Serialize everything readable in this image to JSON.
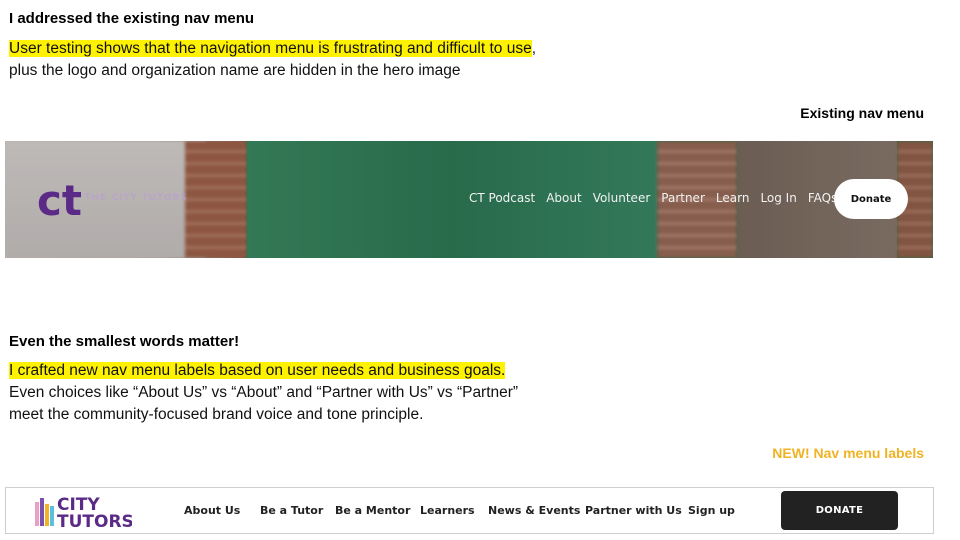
{
  "section1": {
    "heading": "I addressed the existing nav menu",
    "line1_highlight": "User testing shows that the navigation menu is frustrating and difficult to use",
    "line1_tail": ",",
    "line2": "plus the logo and organization name are hidden in the hero image"
  },
  "existing_label": "Existing nav menu",
  "old_nav": {
    "logo_mark": "ct",
    "logo_text": "THE CITY TUTORS",
    "items": [
      "CT Podcast",
      "About",
      "Volunteer",
      "Partner",
      "Learn",
      "Log In",
      "FAQs"
    ],
    "donate_label": "Donate"
  },
  "section2": {
    "heading": "Even the smallest words matter!",
    "line1_highlight": "I crafted new nav menu labels based on user needs and business goals.",
    "line2": "Even choices like “About Us” vs “About” and “Partner with Us” vs “Partner”",
    "line3": "meet the community-focused brand voice and tone principle."
  },
  "new_label": "NEW! Nav menu labels",
  "new_nav": {
    "logo_line1": "CITY",
    "logo_line2": "TUTORS",
    "items": [
      "About Us",
      "Be a Tutor",
      "Be a Mentor",
      "Learners",
      "News & Events",
      "Partner with Us",
      "Sign up"
    ],
    "donate_label": "DONATE"
  },
  "colors": {
    "highlight": "#fff200",
    "new_label": "#f0b323",
    "brand_purple": "#5b2a86"
  }
}
